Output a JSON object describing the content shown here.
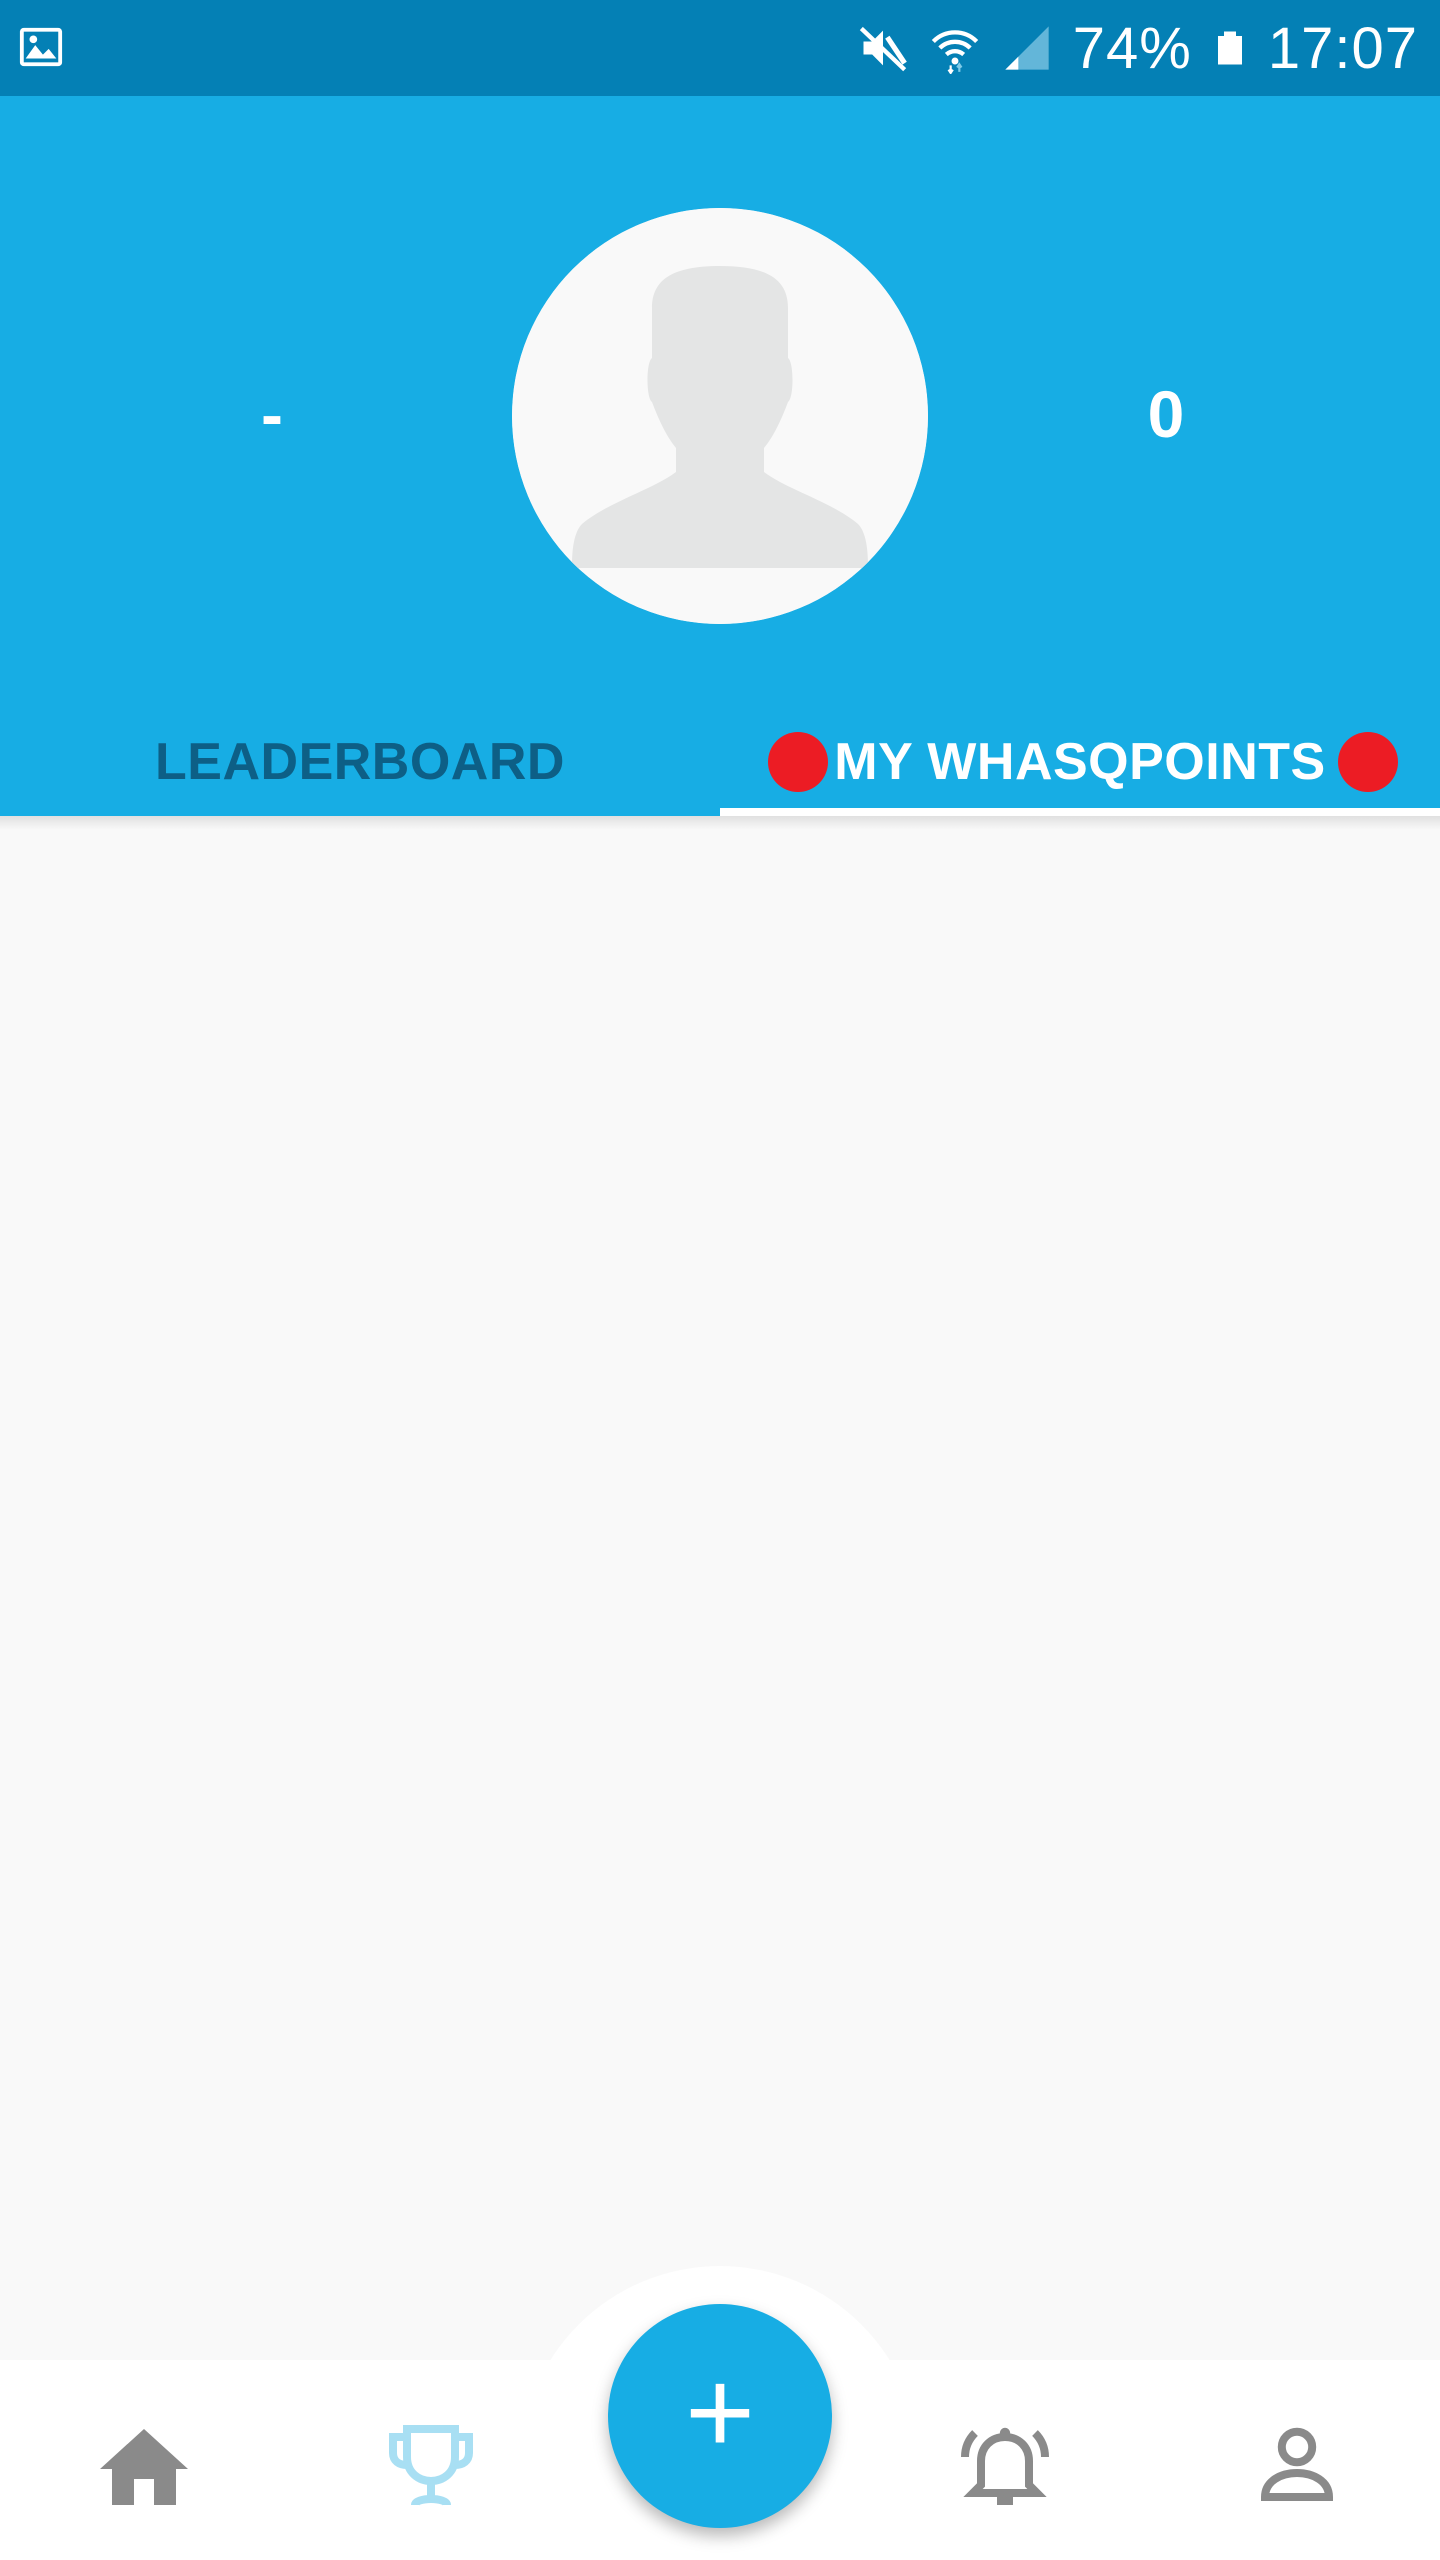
{
  "status_bar": {
    "battery_percent": "74%",
    "time": "17:07",
    "icons": [
      "image-icon",
      "mute-icon",
      "wifi-icon",
      "signal-icon",
      "battery-icon"
    ]
  },
  "profile": {
    "left_stat": "-",
    "right_stat": "0",
    "avatar": "default-avatar"
  },
  "tabs": [
    {
      "label": "LEADERBOARD",
      "active": false
    },
    {
      "label": "MY WHASQPOINTS",
      "active": true
    }
  ],
  "fab": {
    "label": "+"
  },
  "bottom_nav": [
    {
      "name": "home",
      "icon": "home-icon",
      "active": false
    },
    {
      "name": "leaderboard",
      "icon": "trophy-icon",
      "active": true
    },
    {
      "name": "notifications",
      "icon": "alarm-icon",
      "active": false
    },
    {
      "name": "profile",
      "icon": "person-icon",
      "active": false
    }
  ],
  "colors": {
    "status_bar": "#0480b5",
    "header": "#17ade4",
    "tab_inactive": "#0d5f86",
    "badge": "#ec1c24",
    "nav_icon": "#8a8a8a",
    "nav_active": "#a8dff3"
  }
}
